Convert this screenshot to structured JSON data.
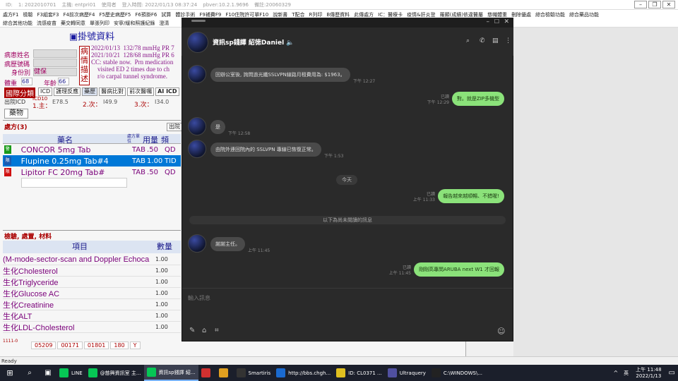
{
  "titlebar": {
    "items": [
      "ID:",
      "1: 2022010701",
      "主機: entpri01",
      "使用者",
      "登入時間: 2022/01/13 08:37:24",
      "pbver:10.2.1.9696",
      "備註:20060329"
    ]
  },
  "menu1": [
    "處方F1",
    "檢驗",
    "F3組套F3",
    "F4前次病歷F4",
    "F5歷史病歷F5",
    "F6預掛F6",
    "試算",
    "體診手術",
    "F9補費F9",
    "F10住院許可單F10",
    "說新書",
    "T配合",
    "R列印",
    "B傳歷資料",
    "此傳處方",
    "IC：醫療卡",
    "疫情&肝炎登",
    "羅顯(成績)依違醫屬",
    "慈幟體重",
    "刪除優處",
    "綜合檢驗功能",
    "綜合藥品功能"
  ],
  "menu2": [
    "綜合其他功能",
    "流感疫苗",
    "藥交轉同意",
    "單張列印",
    "安寧/緩和照護紀錄",
    "澄清"
  ],
  "his": {
    "title": "掛號資料",
    "patient_name_label": "病患姓名",
    "record_no_label": "病歷號碼",
    "identity_label": "身份別",
    "identity_value": "健保",
    "weight_label": "體重",
    "weight_value": "68",
    "age_label": "年齡",
    "age_value": "66",
    "notes_label": "病情描述",
    "notes": [
      "2022/01/13  132/78 mmHg PR 7",
      "2021/10/21  128/68 mmHg PR 6",
      "CC: stable now.  Prn medication",
      "    visited ED 2 times due to ch",
      "    r/o carpal tunnel syndrome."
    ],
    "category_label": "國際分類",
    "tabs": [
      "ICD",
      "護理反應",
      "藥歷",
      "醫病比對",
      "前次醫囑",
      "AI ICD"
    ],
    "discharge_label": "出院ICD",
    "icd10_label": "ICD10",
    "main_label": "1.主：",
    "main_code": "E78.5",
    "second_label": "2.次：",
    "second_code": "I49.9",
    "third_label": "3.次：",
    "third_code": "I34.0",
    "drug_tab": "藥物",
    "rx_label": "處方(3)",
    "out_btn": "出院",
    "drug_headers": [
      "藥名",
      "處方單位",
      "用量",
      "頻"
    ],
    "drugs": [
      {
        "mark": "警",
        "name": "CONCOR 5mg Tab",
        "unit": "TAB",
        "dose": ".50",
        "freq": "QD",
        "mark_color": "#1a9a1a"
      },
      {
        "mark": "限",
        "name": "Flupine 0.25mg Tab#4",
        "unit": "TAB",
        "dose": "1.00",
        "freq": "TID",
        "mark_color": "#1a5ab0"
      },
      {
        "mark": "限",
        "name": "Lipitor FC 20mg Tab#",
        "unit": "TAB",
        "dose": ".50",
        "freq": "QD",
        "mark_color": "#d01010"
      }
    ],
    "proc_label": "檢驗, 處置, 材料",
    "proc_headers": [
      "項目",
      "數量"
    ],
    "procedures": [
      {
        "name": "(M-mode-sector-scan and Doppler Echoca",
        "qty": "1.00"
      },
      {
        "name": "生化Cholesterol",
        "qty": "1.00"
      },
      {
        "name": "生化Triglyceride",
        "qty": "1.00"
      },
      {
        "name": "生化Glucose AC",
        "qty": "1.00"
      },
      {
        "name": "生化Creatinine",
        "qty": "1.00"
      },
      {
        "name": "生化ALT",
        "qty": "1.00"
      },
      {
        "name": "生化LDL-Cholesterol",
        "qty": "1.00"
      }
    ],
    "bottom_code": "1111-0",
    "bottom_values": [
      "05209",
      "00171",
      "01801",
      "180",
      "Y"
    ]
  },
  "chat": {
    "title": "資訊sp錢譯 紹徳Daniel",
    "placeholder": "輸入訊息",
    "messages": [
      {
        "dir": "in",
        "text": "回辦公室後, 詢問過光纖SSLVPN線路月租費用為: $1963。",
        "time": "下午 12:27"
      },
      {
        "dir": "out",
        "text": "對。就是ZIP多機型",
        "time": "下午 12:29",
        "read": "已讀"
      },
      {
        "dir": "in",
        "text": "是",
        "time": "下午 12:58"
      },
      {
        "dir": "in",
        "text": "由院外連回院內的 SSLVPN 專線已恢復正常。",
        "time": "下午 1:53"
      },
      {
        "dir": "date",
        "text": "今天"
      },
      {
        "dir": "out",
        "text": "報告越來越順暢、不錯喔!",
        "time": "上午 11:33",
        "read": "已讀"
      },
      {
        "dir": "divider",
        "text": "以下為尚未閱讀的訊息"
      },
      {
        "dir": "in",
        "text": "謝謝主任。",
        "time": "上午 11:45"
      },
      {
        "dir": "out",
        "text": "剛剛高專問ARUBA next W1 才回報",
        "time": "上午 11:45",
        "read": "已讀"
      }
    ]
  },
  "status": "Ready",
  "taskbar": {
    "items": [
      {
        "label": "LINE",
        "color": "#06c755"
      },
      {
        "label": "@慈興資訊室 主...",
        "color": "#06c755"
      },
      {
        "label": "資訊sp錢譯 紹...",
        "color": "#06c755",
        "active": true
      },
      {
        "label": "",
        "color": "#d03030"
      },
      {
        "label": "",
        "color": "#e0a020"
      },
      {
        "label": "Smartiris",
        "color": "#333"
      },
      {
        "label": "http://bbs.chgh...",
        "color": "#1a6ad0"
      },
      {
        "label": "ID: CL0371  ...",
        "color": "#e0c020"
      },
      {
        "label": "Ultraquery",
        "color": "#5050a0"
      },
      {
        "label": "C:\\WINDOWS\\...",
        "color": "#222"
      }
    ],
    "ime": "英",
    "time": "上午 11:48",
    "date": "2022/1/13"
  }
}
